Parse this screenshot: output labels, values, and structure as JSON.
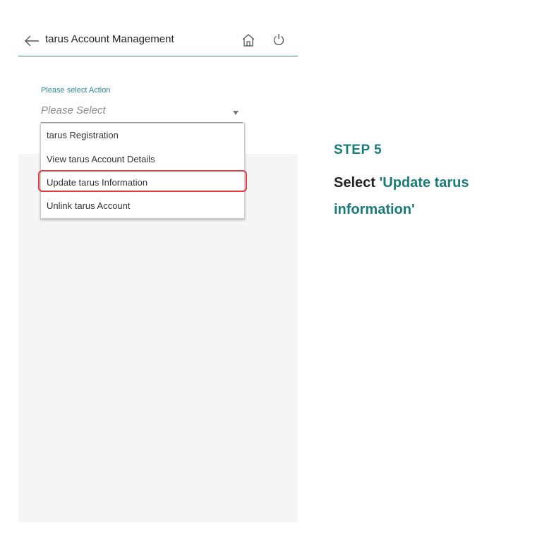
{
  "header": {
    "title": "tarus Account Management"
  },
  "form": {
    "field_label": "Please select Action",
    "select_placeholder": "Please Select",
    "options": [
      "tarus Registration",
      "View tarus Account Details",
      "Update tarus Information",
      "Unlink tarus Account"
    ],
    "highlighted_option_index": 2
  },
  "instruction": {
    "step": "STEP 5",
    "text_prefix": "Select",
    "text_highlight": "'Update tarus information'"
  },
  "colors": {
    "accent": "#2e8b8b",
    "step_text": "#1b7a7a",
    "highlight_border": "#e0393e"
  },
  "icons": [
    "back-arrow-icon",
    "home-icon",
    "power-icon",
    "dropdown-caret-icon"
  ]
}
